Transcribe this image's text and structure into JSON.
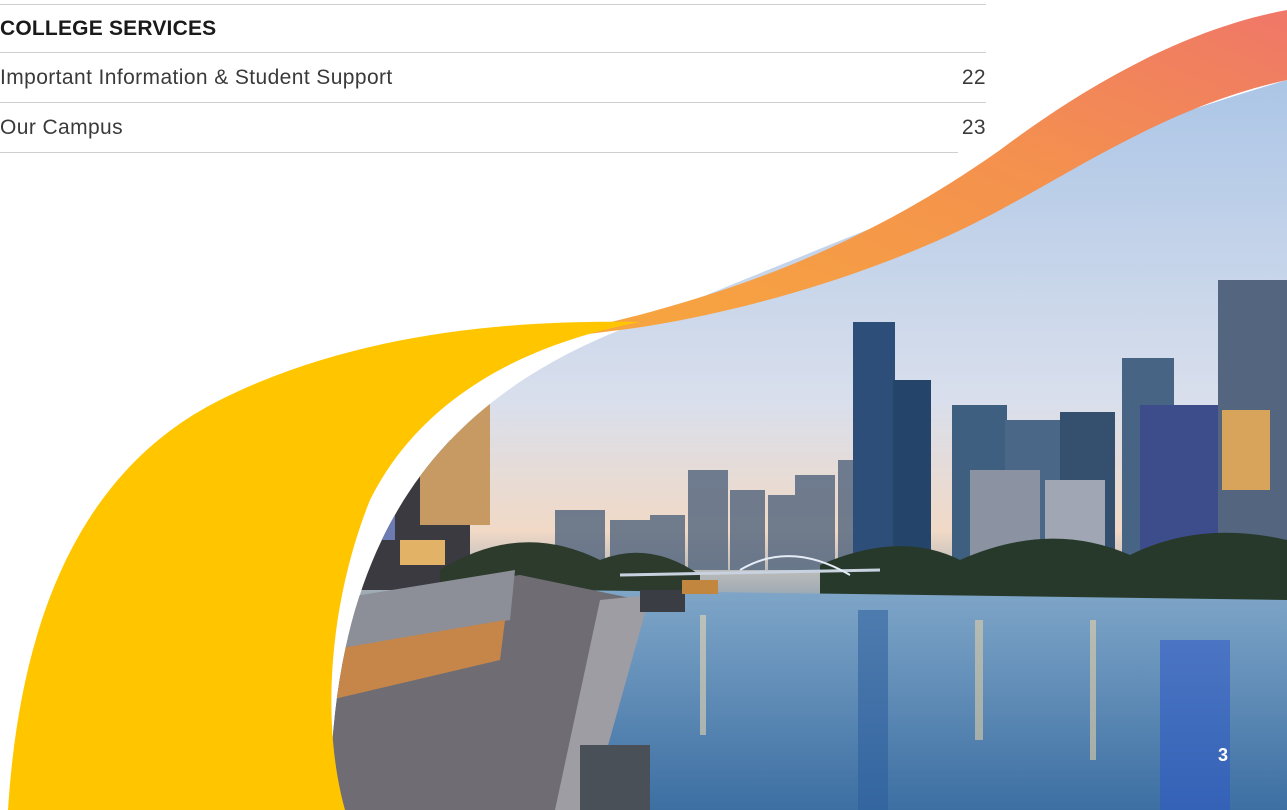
{
  "toc": {
    "heading": "COLLEGE SERVICES",
    "entries": [
      {
        "title": "Important Information & Student Support",
        "page": "22"
      },
      {
        "title": "Our Campus",
        "page": "23"
      }
    ]
  },
  "footer": {
    "page_number": "3"
  },
  "colors": {
    "yellow": "#FFC600",
    "orange": "#F59A4A",
    "coral": "#EF7768",
    "text": "#3a3a3a"
  }
}
